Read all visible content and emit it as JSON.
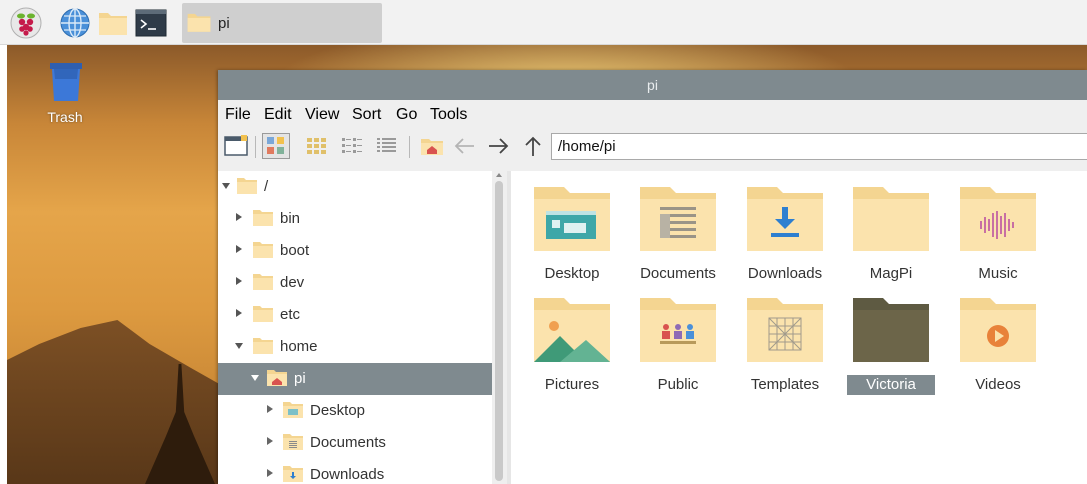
{
  "taskbar": {
    "icons": [
      "raspberry-menu-icon",
      "web-browser-icon",
      "file-manager-icon",
      "terminal-icon"
    ],
    "task_label": "pi"
  },
  "desktop": {
    "trash_label": "Trash"
  },
  "window": {
    "title": "pi",
    "menu": [
      "File",
      "Edit",
      "View",
      "Sort",
      "Go",
      "Tools"
    ],
    "path": "/home/pi",
    "tree": [
      {
        "label": "/",
        "expanded": true
      },
      {
        "label": "bin"
      },
      {
        "label": "boot"
      },
      {
        "label": "dev"
      },
      {
        "label": "etc"
      },
      {
        "label": "home",
        "expanded": true
      },
      {
        "label": "pi",
        "expanded": true,
        "selected": true
      },
      {
        "label": "Desktop"
      },
      {
        "label": "Documents"
      },
      {
        "label": "Downloads"
      }
    ],
    "folders": [
      {
        "label": "Desktop",
        "icon": "desktop-folder-icon"
      },
      {
        "label": "Documents",
        "icon": "documents-folder-icon"
      },
      {
        "label": "Downloads",
        "icon": "downloads-folder-icon"
      },
      {
        "label": "MagPi",
        "icon": "folder-icon"
      },
      {
        "label": "Music",
        "icon": "music-folder-icon"
      },
      {
        "label": "Pictures",
        "icon": "pictures-folder-icon"
      },
      {
        "label": "Public",
        "icon": "public-folder-icon"
      },
      {
        "label": "Templates",
        "icon": "templates-folder-icon"
      },
      {
        "label": "Victoria",
        "icon": "folder-icon",
        "selected": true
      },
      {
        "label": "Videos",
        "icon": "videos-folder-icon"
      }
    ]
  },
  "colors": {
    "folder_back": "#f4d591",
    "folder_front": "#fbe3ad",
    "folder_selected": "#6c6549",
    "selection": "#7f8a8f",
    "accent_blue": "#2d7fd0"
  }
}
